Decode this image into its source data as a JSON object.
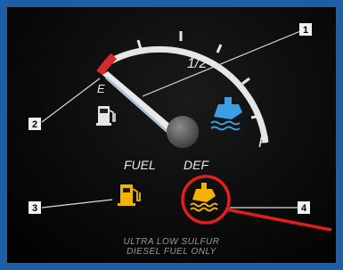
{
  "gauge": {
    "half_label": "1/2",
    "full_label": "F",
    "empty_label": "E"
  },
  "labels": {
    "fuel": "FUEL",
    "def": "DEF"
  },
  "callouts": [
    "1",
    "2",
    "3",
    "4"
  ],
  "footer": {
    "line1": "ULTRA LOW SULFUR",
    "line2": "DIESEL FUEL  ONLY"
  },
  "colors": {
    "background_frame": "#1d5fa6",
    "fuel_warning": "#f2b400",
    "def_warning": "#f2b400",
    "highlight_circle": "#e01e1e",
    "empty_zone": "#d42a2a",
    "def_pump_icon": "#3aa0e6"
  }
}
